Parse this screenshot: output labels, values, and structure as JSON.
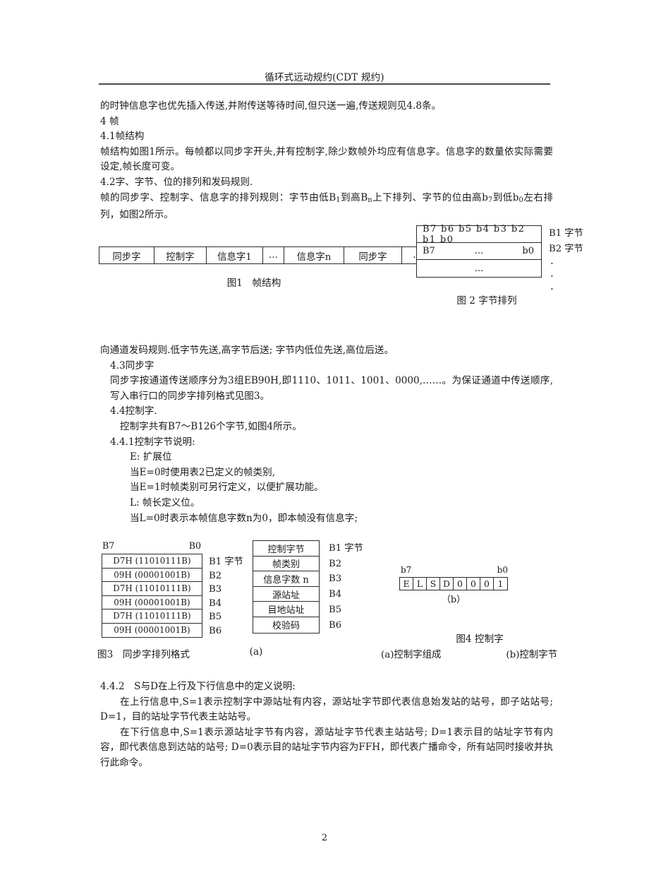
{
  "header": {
    "title": "循环式远动规约(CDT 规约)"
  },
  "body": {
    "para1": "的时钟信息字也优先插入传送,并附传送等待时间,但只送一遍,传送规则见4.8条。",
    "sec4": "4 帧",
    "sec41_heading": "4.1帧结构",
    "sec41_text": "帧结构如图1所示。每帧都以同步字开头,并有控制字,除少数帧外均应有信息字。信息字的数量依实际需要设定,帧长度可变。",
    "sec42_heading": "4.2字、字节、位的排列和发码规则.",
    "sec42_text_a": "帧的同步字、控制字、信息字的排列规则：字节由低B",
    "sec42_text_b": "到高B",
    "sec42_text_c": "上下排列、字节的位由高b",
    "sec42_text_d": "到低b",
    "sec42_text_e": "左右排列，如图2所示。",
    "sec42_sub1": "1",
    "sec42_sub2": "n",
    "sec42_sub3": "7",
    "sec42_sub4": "0",
    "para_channel": "向通道发码规则.低字节先送,高字节后送; 字节内低位先送,高位后送。",
    "sec43_heading": "4.3同步字",
    "sec43_text": "同步字按通道传送顺序分为3组EB90H,即1110、1011、1001、0000,……。为保证通道中传送顺序,写入串行口的同步字排列格式见图3。",
    "sec44_heading": "4.4控制字.",
    "sec44_text": "控制字共有B7～B126个字节,如图4所示。",
    "sec441_heading": "4.4.1控制字节说明:",
    "sec441_l1": "E: 扩展位",
    "sec441_l2": "当E=0时使用表2已定义的帧类别,",
    "sec441_l3": "当E=1时帧类别可另行定义，以便扩展功能。",
    "sec441_l4": "L: 帧长定义位。",
    "sec441_l5": "当L=0时表示本帧信息字数n为0，即本帧没有信息字;",
    "sec442_heading": "4.4.2　S与D在上行及下行信息中的定义说明:",
    "sec442_p1": "在上行信息中,S=1表示控制字中源站址有内容，源站址字节即代表信息始发站的站号，即子站站号; D=1，目的站址字节代表主站站号。",
    "sec442_p2": "在下行信息中,S=1表示源站址字节有内容，源站址字节代表主站站号; D=1表示目的站址字节有内容，即代表信息到达站的站号; D=0表示目的站址字节内容为FFH，即代表广播命令，所有站同时接收并执行此命令。"
  },
  "figure1": {
    "cells": [
      "同步字",
      "控制字",
      "信息字1",
      "…",
      "信息字n",
      "同步字",
      "…"
    ],
    "caption": "图1　帧结构"
  },
  "figure2": {
    "row1_bits": "B7 b6 b5 b4 b3 b2 b1 b0",
    "row2_left": "B7",
    "row2_mid": "…",
    "row2_right": "b0",
    "row3_mid": "…",
    "labels": [
      "B1 字节",
      "B2 字节"
    ],
    "dots": [
      "·",
      "·",
      "·"
    ],
    "caption": "图 2  字节排列"
  },
  "figure3": {
    "head_left": "B7",
    "head_right": "B0",
    "rows": [
      "D7H (11010111B)",
      "09H (00001001B)",
      "D7H (11010111B)",
      "09H (00001001B)",
      "D7H (11010111B)",
      "09H (00001001B)"
    ],
    "labels": [
      "B1 字节",
      "B2",
      "B3",
      "B4",
      "B5",
      "B6"
    ],
    "caption": "图3　同步字排列格式"
  },
  "figure4a": {
    "rows": [
      "控制字节",
      "帧类别",
      "信息字数 n",
      "源站址",
      "目地站址",
      "校验码"
    ],
    "labels": [
      "B1 字节",
      "B2",
      "B3",
      "B4",
      "B5",
      "B6"
    ],
    "caption": "(a)"
  },
  "figure4b": {
    "head_left": "b7",
    "head_right": "b0",
    "cells": [
      "E",
      "L",
      "S",
      "D",
      "0",
      "0",
      "0",
      "1"
    ],
    "sublabel": "（b）"
  },
  "figure4": {
    "title": "图4  控制字",
    "caption_a": "(a)控制字组成",
    "caption_b": "(b)控制字节"
  },
  "footer": {
    "page_number": "2"
  }
}
